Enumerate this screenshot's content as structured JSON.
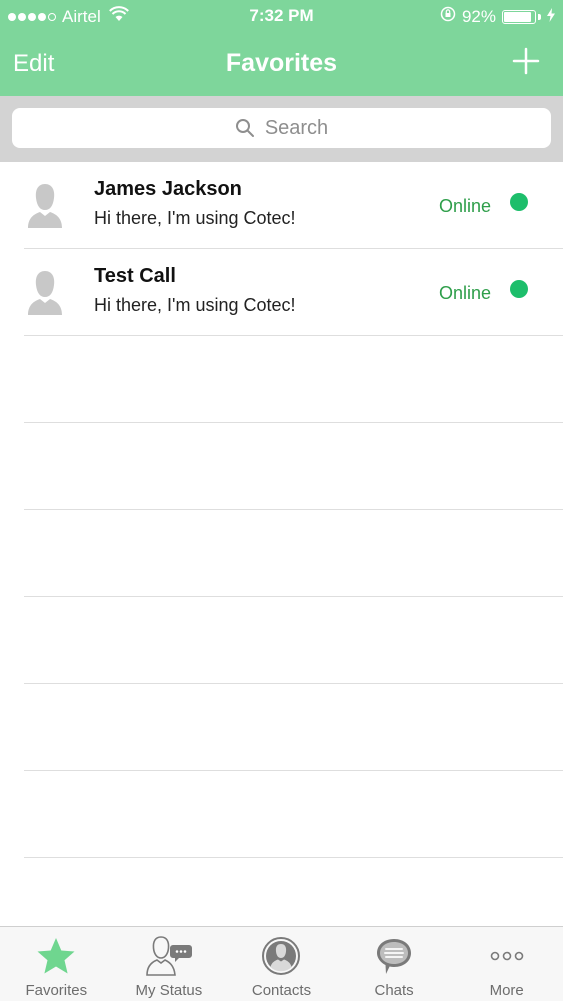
{
  "status_bar": {
    "carrier": "Airtel",
    "time": "7:32 PM",
    "battery_percent": "92%",
    "battery_level": 0.92,
    "signal_bars": 4
  },
  "nav": {
    "edit_label": "Edit",
    "title": "Favorites"
  },
  "search": {
    "placeholder": "Search"
  },
  "contacts": [
    {
      "name": "James Jackson",
      "message": "Hi there, I'm using Cotec!",
      "status": "Online"
    },
    {
      "name": "Test Call",
      "message": "Hi there, I'm using Cotec!",
      "status": "Online"
    }
  ],
  "tabs": [
    {
      "label": "Favorites",
      "icon": "star-icon",
      "active": true
    },
    {
      "label": "My Status",
      "icon": "my-status-icon",
      "active": false
    },
    {
      "label": "Contacts",
      "icon": "contacts-icon",
      "active": false
    },
    {
      "label": "Chats",
      "icon": "chats-icon",
      "active": false
    },
    {
      "label": "More",
      "icon": "more-icon",
      "active": false
    }
  ],
  "colors": {
    "header": "#7ed69b",
    "online_text": "#2e9e4a",
    "online_dot": "#1dbe6b",
    "active_tab_icon": "#6fd68f"
  }
}
